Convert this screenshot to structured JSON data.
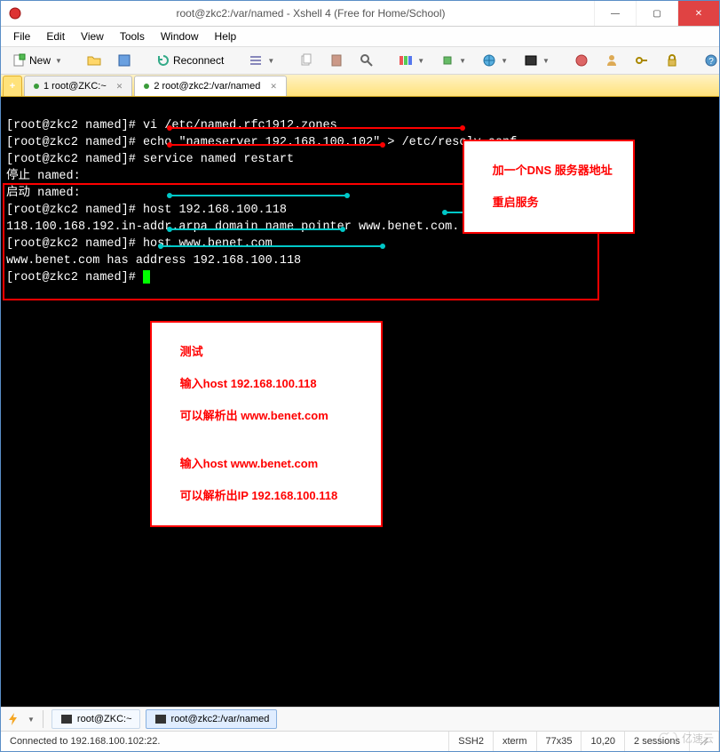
{
  "window": {
    "title": "root@zkc2:/var/named - Xshell 4 (Free for Home/School)",
    "min": "—",
    "max": "▢",
    "close": "✕"
  },
  "menus": [
    "File",
    "Edit",
    "View",
    "Tools",
    "Window",
    "Help"
  ],
  "toolbar": {
    "new": "New",
    "reconnect": "Reconnect"
  },
  "tabs": {
    "add": "+",
    "tab1": "1 root@ZKC:~",
    "tab2": "2 root@zkc2:/var/named"
  },
  "term": {
    "l1p": "[root@zkc2 named]# ",
    "l1c": "vi /etc/named.rfc1912.zones",
    "l2p": "[root@zkc2 named]# ",
    "l2c": "echo \"nameserver 192.168.100.102\" > /etc/resolv.conf",
    "l3p": "[root@zkc2 named]# ",
    "l3c": "service named restart",
    "l4": "停止 named:",
    "l5": "启动 named:",
    "l6p": "[root@zkc2 named]# ",
    "l6c": "host 192.168.100.118",
    "l7": "118.100.168.192.in-addr.arpa domain name pointer www.benet.com.",
    "l8p": "[root@zkc2 named]# ",
    "l8c": "host www.benet.com",
    "l9": "www.benet.com has address 192.168.100.118",
    "l10p": "[root@zkc2 named]# "
  },
  "annotations": {
    "note1_l1": "加一个DNS 服务器地址",
    "note1_l2": "重启服务",
    "note2_l1": "测试",
    "note2_l2": "输入host 192.168.100.118",
    "note2_l3": "可以解析出 www.benet.com",
    "note2_l4": "输入host www.benet.com",
    "note2_l5": "可以解析出IP 192.168.100.118"
  },
  "bottom": {
    "tab1": "root@ZKC:~",
    "tab2": "root@zkc2:/var/named"
  },
  "status": {
    "conn": "Connected to 192.168.100.102:22.",
    "proto": "SSH2",
    "term": "xterm",
    "size": "77x35",
    "pos": "10,20",
    "sess": "2 sessions"
  },
  "watermark": "亿速云"
}
